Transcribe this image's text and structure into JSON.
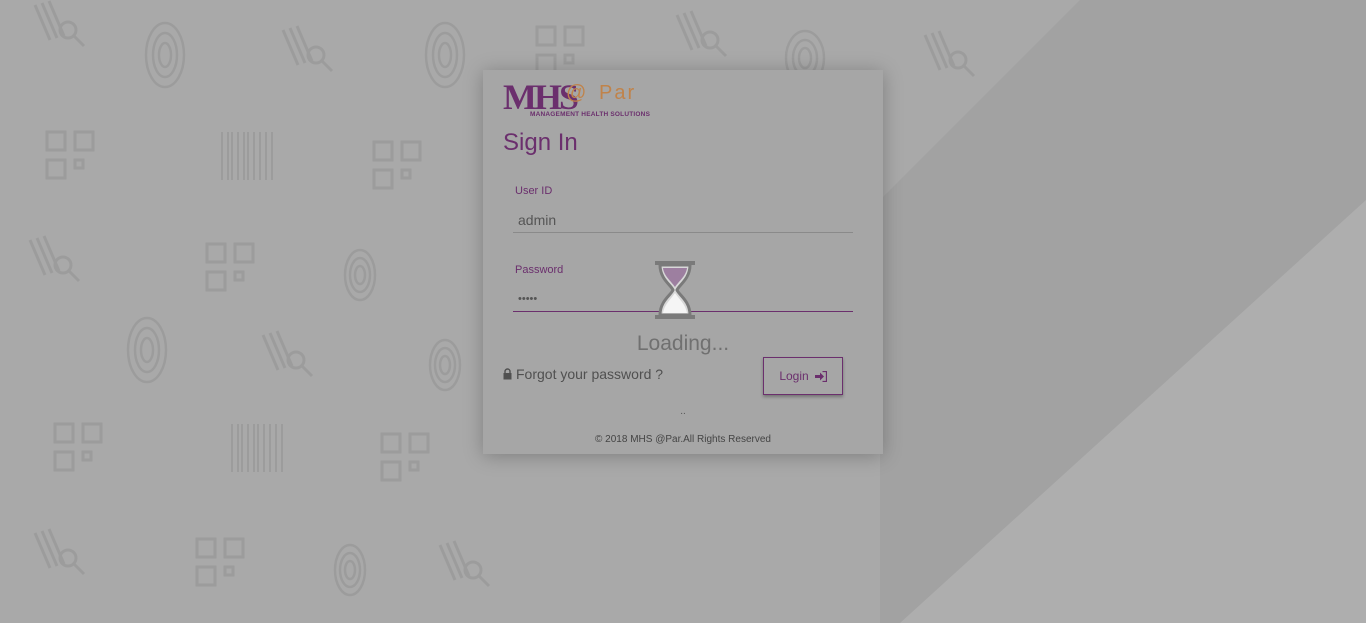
{
  "logo": {
    "mhs": "MHS",
    "at": "@",
    "par": "Par",
    "subtitle": "MANAGEMENT HEALTH SOLUTIONS"
  },
  "title": "Sign In",
  "user_id": {
    "label": "User ID",
    "value": "admin"
  },
  "password": {
    "label": "Password",
    "value": "•••••"
  },
  "loading_text": "Loading...",
  "forgot_link": "Forgot your password ?",
  "login_button": "Login",
  "dots": "..",
  "footer": "© 2018 MHS @Par.All Rights Reserved",
  "colors": {
    "brand_purple": "#6b2f6d",
    "brand_orange": "#c0834a",
    "overlay_gray": "#a9a9a9"
  },
  "icons": {
    "lock": "lock-icon",
    "login": "sign-in-icon",
    "hourglass": "hourglass-icon"
  }
}
